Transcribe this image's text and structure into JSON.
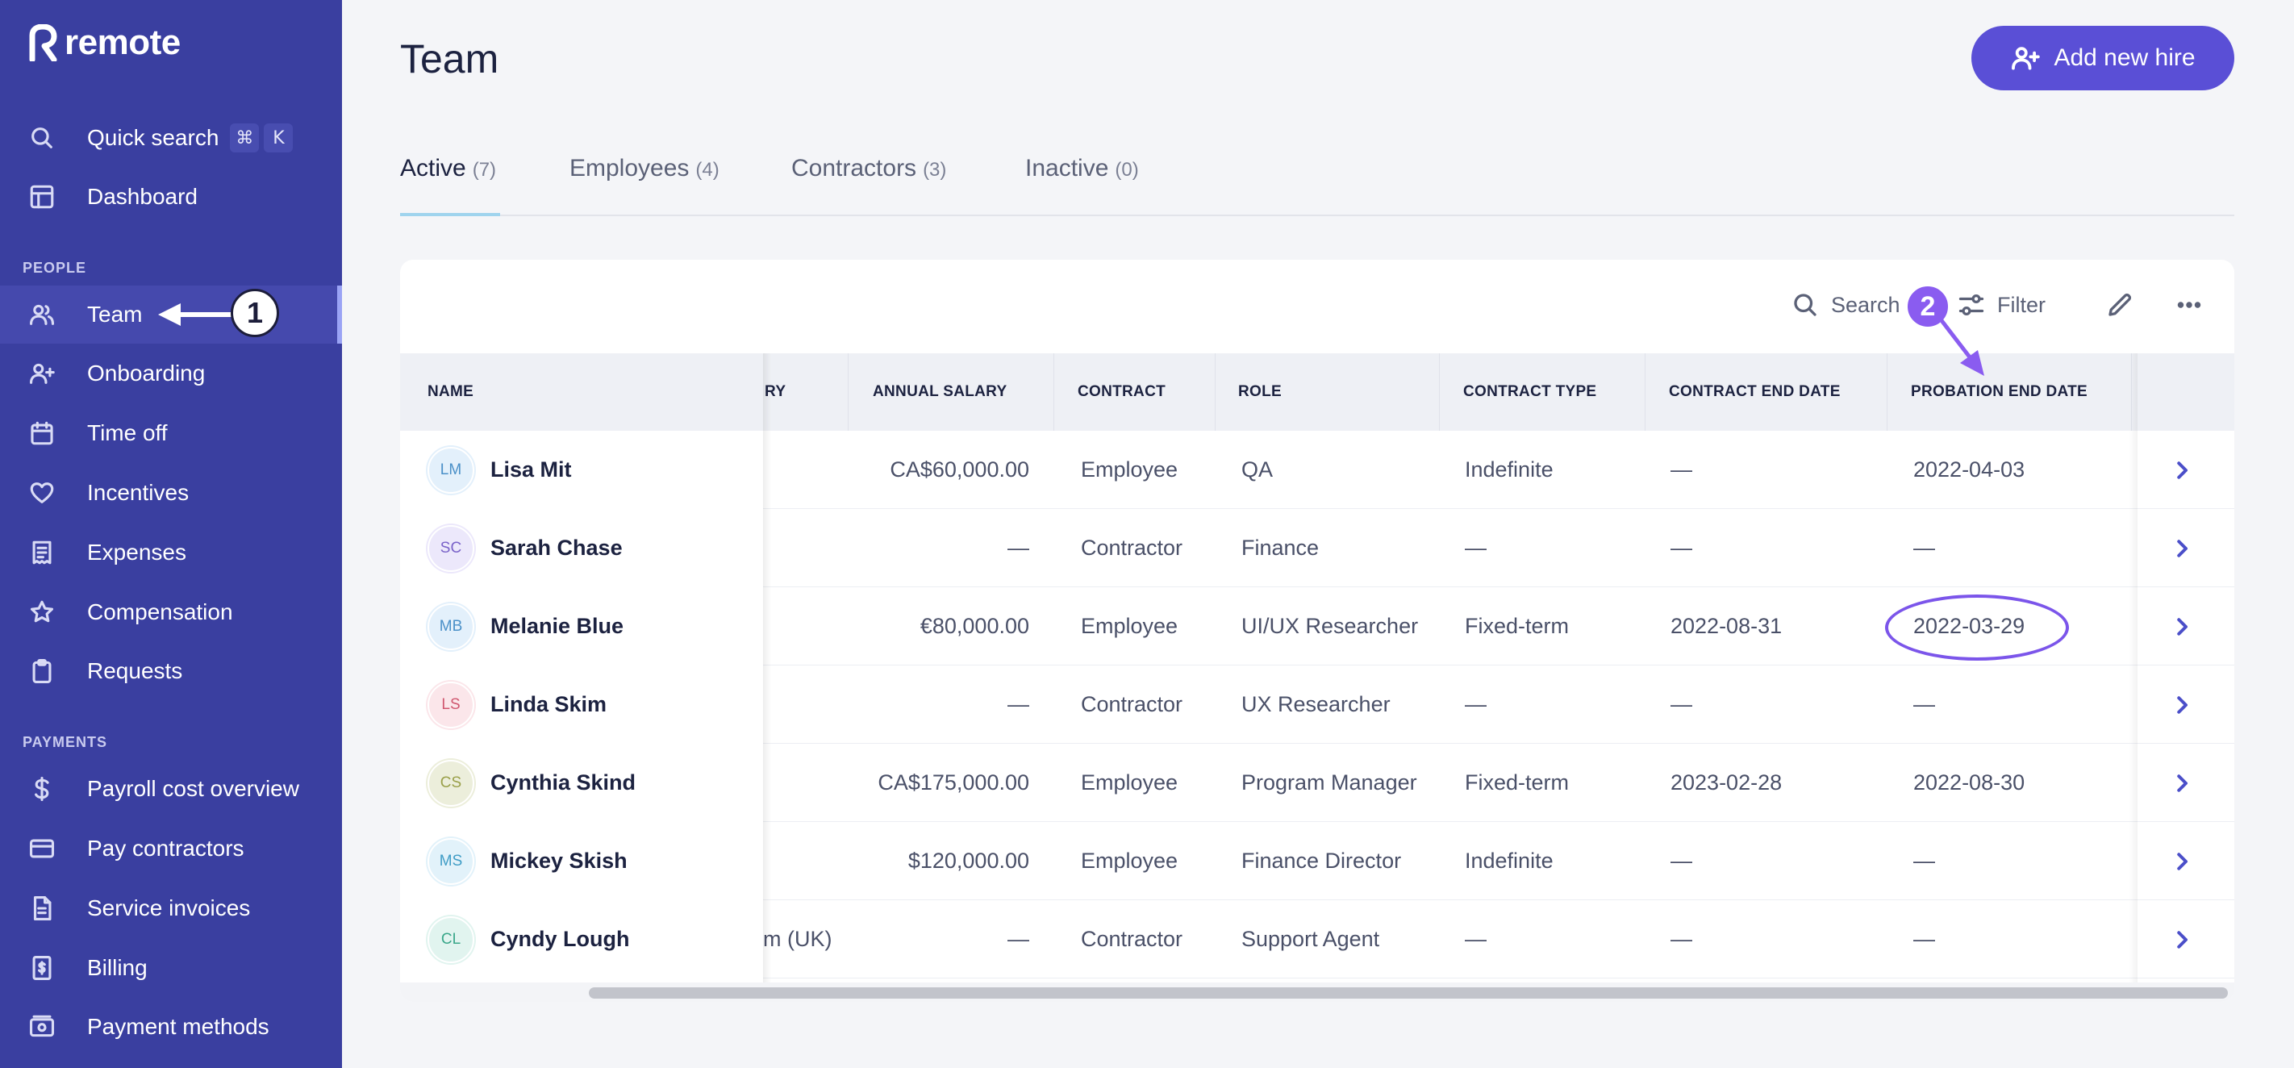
{
  "app": {
    "brand": "remote"
  },
  "sidebar": {
    "quick_search": {
      "label": "Quick search",
      "keys": [
        "⌘",
        "K"
      ]
    },
    "dashboard": "Dashboard",
    "people_section": "PEOPLE",
    "people_items": [
      {
        "label": "Team",
        "icon": "users-icon",
        "active": true
      },
      {
        "label": "Onboarding",
        "icon": "user-plus-icon"
      },
      {
        "label": "Time off",
        "icon": "calendar-icon"
      },
      {
        "label": "Incentives",
        "icon": "heart-icon"
      },
      {
        "label": "Expenses",
        "icon": "receipt-icon"
      },
      {
        "label": "Compensation",
        "icon": "star-icon"
      },
      {
        "label": "Requests",
        "icon": "clipboard-icon"
      }
    ],
    "payments_section": "PAYMENTS",
    "payments_items": [
      {
        "label": "Payroll cost overview",
        "icon": "dollar-icon"
      },
      {
        "label": "Pay contractors",
        "icon": "credit-card-icon"
      },
      {
        "label": "Service invoices",
        "icon": "invoice-icon"
      },
      {
        "label": "Billing",
        "icon": "bill-icon"
      },
      {
        "label": "Payment methods",
        "icon": "wallet-icon"
      }
    ]
  },
  "annotations": {
    "step1": "1",
    "step2": "2",
    "accent": "#7b55ea"
  },
  "header": {
    "title": "Team",
    "add_button": "Add new hire"
  },
  "tabs": [
    {
      "label": "Active",
      "count": "(7)",
      "active": true
    },
    {
      "label": "Employees",
      "count": "(4)"
    },
    {
      "label": "Contractors",
      "count": "(3)"
    },
    {
      "label": "Inactive",
      "count": "(0)"
    }
  ],
  "toolbar": {
    "search": "Search",
    "filter": "Filter"
  },
  "table": {
    "columns": {
      "name": "NAME",
      "partial": "RY",
      "annual_salary": "ANNUAL SALARY",
      "contract": "CONTRACT",
      "role": "ROLE",
      "contract_type": "CONTRACT TYPE",
      "contract_end": "CONTRACT END DATE",
      "probation_end": "PROBATION END DATE"
    },
    "rows": [
      {
        "initials": "LM",
        "name": "Lisa Mit",
        "partial": "",
        "salary": "CA$60,000.00",
        "contract": "Employee",
        "role": "QA",
        "contract_type": "Indefinite",
        "contract_end": "—",
        "probation_end": "2022-04-03",
        "avatar_bg": "#e3f0fb",
        "avatar_fg": "#4a90c8"
      },
      {
        "initials": "SC",
        "name": "Sarah Chase",
        "partial": "",
        "salary": "—",
        "contract": "Contractor",
        "role": "Finance",
        "contract_type": "—",
        "contract_end": "—",
        "probation_end": "—",
        "avatar_bg": "#ece8fb",
        "avatar_fg": "#7a63c9"
      },
      {
        "initials": "MB",
        "name": "Melanie Blue",
        "partial": "",
        "salary": "€80,000.00",
        "contract": "Employee",
        "role": "UI/UX Researcher",
        "contract_type": "Fixed-term",
        "contract_end": "2022-08-31",
        "probation_end": "2022-03-29",
        "avatar_bg": "#e3f0fb",
        "avatar_fg": "#4a90c8"
      },
      {
        "initials": "LS",
        "name": "Linda Skim",
        "partial": "",
        "salary": "—",
        "contract": "Contractor",
        "role": "UX Researcher",
        "contract_type": "—",
        "contract_end": "—",
        "probation_end": "—",
        "avatar_bg": "#fbe6ea",
        "avatar_fg": "#d0576f"
      },
      {
        "initials": "CS",
        "name": "Cynthia Skind",
        "partial": "",
        "salary": "CA$175,000.00",
        "contract": "Employee",
        "role": "Program Manager",
        "contract_type": "Fixed-term",
        "contract_end": "2023-02-28",
        "probation_end": "2022-08-30",
        "avatar_bg": "#eceedb",
        "avatar_fg": "#9aa04a"
      },
      {
        "initials": "MS",
        "name": "Mickey Skish",
        "partial": "",
        "salary": "$120,000.00",
        "contract": "Employee",
        "role": "Finance Director",
        "contract_type": "Indefinite",
        "contract_end": "—",
        "probation_end": "—",
        "avatar_bg": "#e2f2fa",
        "avatar_fg": "#3f9dc6"
      },
      {
        "initials": "CL",
        "name": "Cyndy Lough",
        "partial": "m (UK)",
        "salary": "—",
        "contract": "Contractor",
        "role": "Support Agent",
        "contract_type": "—",
        "contract_end": "—",
        "probation_end": "—",
        "avatar_bg": "#e1f4ef",
        "avatar_fg": "#3aa78a"
      }
    ]
  }
}
